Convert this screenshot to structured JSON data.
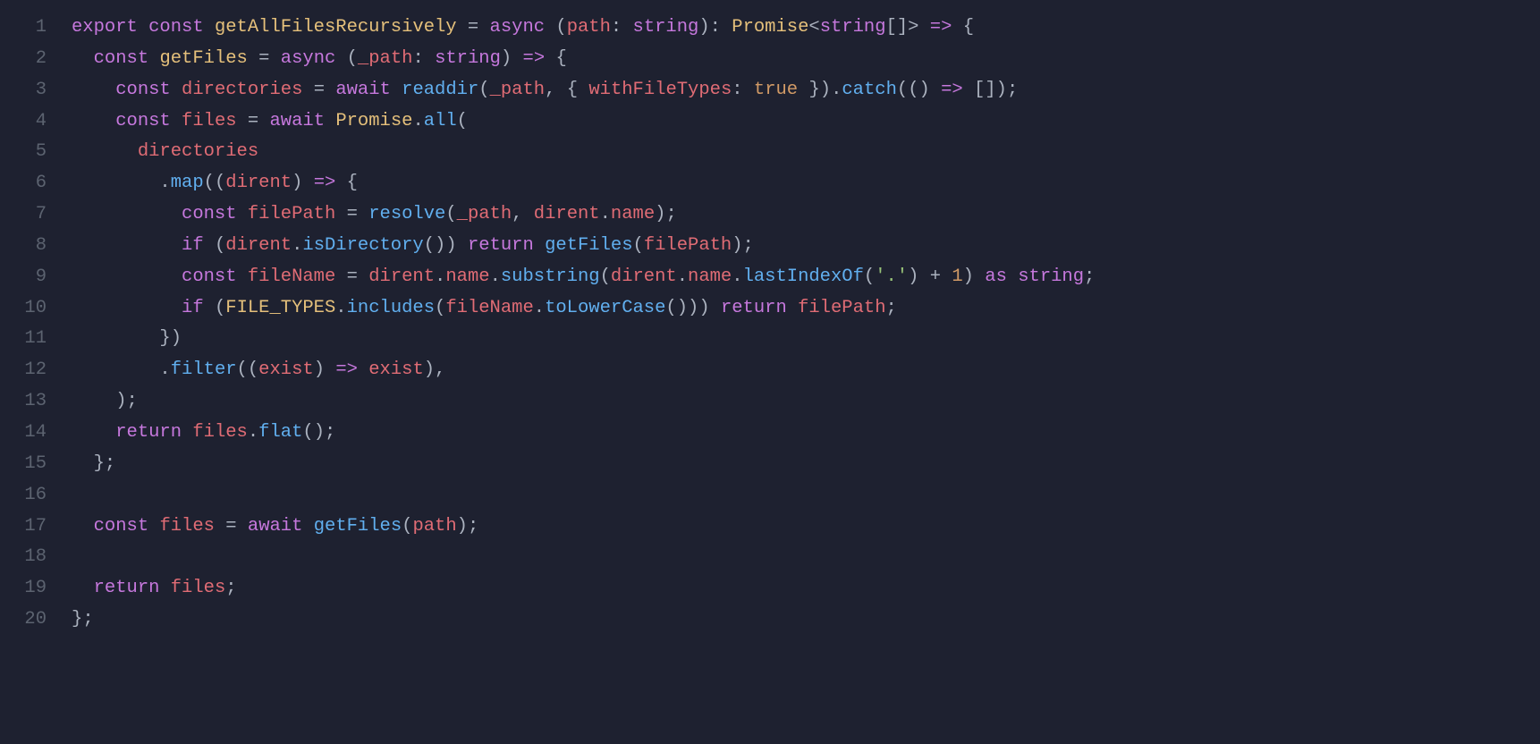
{
  "lineNumbers": [
    "1",
    "2",
    "3",
    "4",
    "5",
    "6",
    "7",
    "8",
    "9",
    "10",
    "11",
    "12",
    "13",
    "14",
    "15",
    "16",
    "17",
    "18",
    "19",
    "20"
  ],
  "tokens": {
    "export": "export",
    "const": "const",
    "async": "async",
    "await": "await",
    "return": "return",
    "if": "if",
    "as": "as",
    "getAllFilesRecursively": "getAllFilesRecursively",
    "getFiles": "getFiles",
    "path": "path",
    "_path": "_path",
    "string": "string",
    "Promise": "Promise",
    "directories": "directories",
    "readdir": "readdir",
    "withFileTypes": "withFileTypes",
    "true": "true",
    "catch": "catch",
    "files": "files",
    "all": "all",
    "map": "map",
    "dirent": "dirent",
    "filePath": "filePath",
    "resolve": "resolve",
    "name": "name",
    "isDirectory": "isDirectory",
    "fileName": "fileName",
    "substring": "substring",
    "lastIndexOf": "lastIndexOf",
    "dotString": "'.'",
    "plus": "+",
    "one": "1",
    "FILE_TYPES": "FILE_TYPES",
    "includes": "includes",
    "toLowerCase": "toLowerCase",
    "filter": "filter",
    "exist": "exist",
    "flat": "flat"
  }
}
